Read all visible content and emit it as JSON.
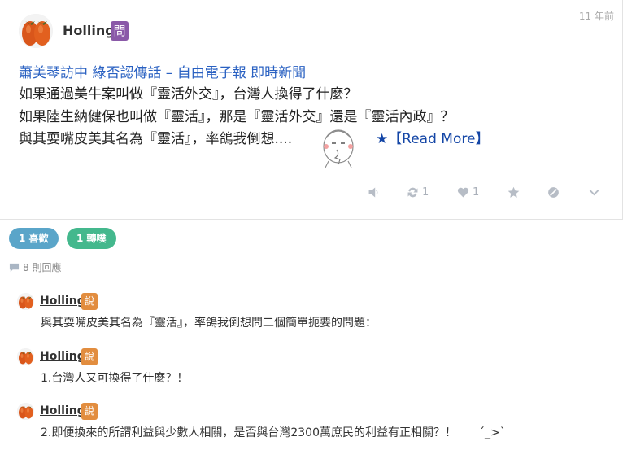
{
  "post": {
    "author": "Holling",
    "badge": "問",
    "time_ago": "11 年前",
    "title_link": "蕭美琴訪中 綠否認傳話 – 自由電子報 即時新聞",
    "lines": [
      "如果通過美牛案叫做『靈活外交』，台灣人換得了什麼？",
      "如果陸生納健保也叫做『靈活』，那是『靈活外交』還是『靈活內政』？",
      "與其耍嘴皮美其名為『靈活』，率鴿我倒想...."
    ],
    "read_more": "★【Read More】",
    "actions": {
      "reblog_count": "1",
      "like_count": "1"
    }
  },
  "reactions": {
    "likes_label": "1 喜歡",
    "shares_label": "1 轉噗"
  },
  "replies_header": "8 則回應",
  "replies": [
    {
      "name": "Holling",
      "badge": "說",
      "text": "與其耍嘴皮美其名為『靈活』，率鴿我倒想問二個簡單扼要的問題："
    },
    {
      "name": "Holling",
      "badge": "說",
      "text": "1.台灣人又可換得了什麼？！"
    },
    {
      "name": "Holling",
      "badge": "說",
      "text": "2.即便換來的所謂利益與少數人相關，是否與台灣2300萬庶民的利益有正相關？！　　ˊ_>ˋ"
    }
  ],
  "colors": {
    "link": "#2a61c2",
    "question_badge": "#8a59a8",
    "say_badge": "#e28d3f",
    "likes_pill": "#5aa5c9",
    "shares_pill": "#44b88d"
  }
}
